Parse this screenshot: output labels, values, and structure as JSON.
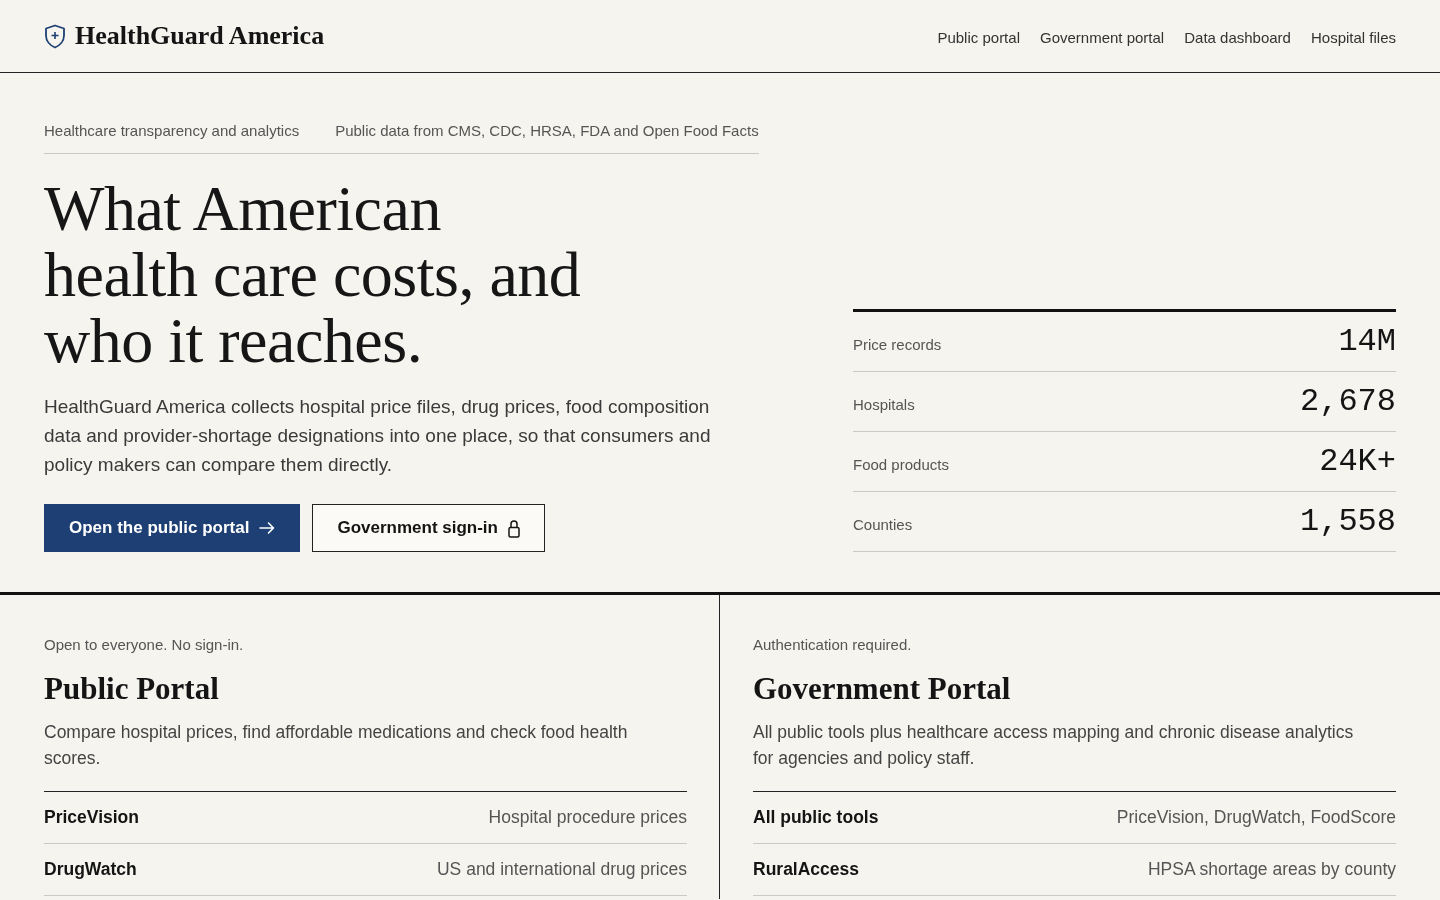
{
  "header": {
    "brand": "HealthGuard America",
    "nav": [
      "Public portal",
      "Government portal",
      "Data dashboard",
      "Hospital files"
    ]
  },
  "hero": {
    "eyebrows": [
      "Healthcare transparency and analytics",
      "Public data from CMS, CDC, HRSA, FDA and Open Food Facts"
    ],
    "headline": "What American health care costs, and who it reaches.",
    "intro": "HealthGuard America collects hospital price files, drug prices, food composition data and provider-shortage designations into one place, so that consumers and policy makers can compare them directly.",
    "actions": [
      {
        "label": "Open the public portal",
        "kind": "primary"
      },
      {
        "label": "Government sign-in",
        "kind": "secondary"
      }
    ]
  },
  "stats": [
    {
      "label": "Price records",
      "value": "14M"
    },
    {
      "label": "Hospitals",
      "value": "2,678"
    },
    {
      "label": "Food products",
      "value": "24K+"
    },
    {
      "label": "Counties",
      "value": "1,558"
    }
  ],
  "portals": [
    {
      "note": "Open to everyone. No sign-in.",
      "title": "Public Portal",
      "description": "Compare hospital prices, find affordable medications and check food health scores.",
      "tools": [
        {
          "name": "PriceVision",
          "description": "Hospital procedure prices"
        },
        {
          "name": "DrugWatch",
          "description": "US and international drug prices"
        }
      ]
    },
    {
      "note": "Authentication required.",
      "title": "Government Portal",
      "description": "All public tools plus healthcare access mapping and chronic disease analytics for agencies and policy staff.",
      "tools": [
        {
          "name": "All public tools",
          "description": "PriceVision, DrugWatch, FoodScore"
        },
        {
          "name": "RuralAccess",
          "description": "HPSA shortage areas by county"
        }
      ]
    }
  ]
}
